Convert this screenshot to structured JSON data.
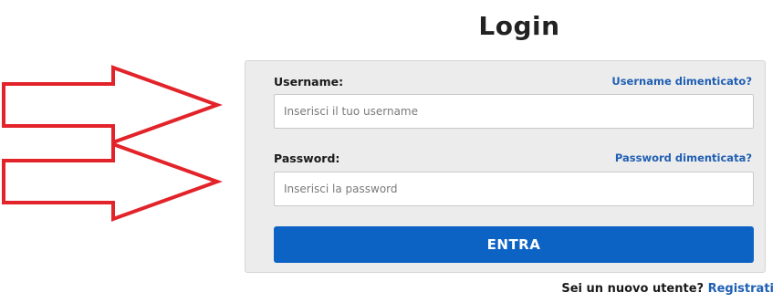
{
  "page": {
    "title": "Login"
  },
  "username": {
    "label": "Username:",
    "forgot_link": "Username dimenticato?",
    "placeholder": "Inserisci il tuo username",
    "value": ""
  },
  "password": {
    "label": "Password:",
    "forgot_link": "Password dimenticata?",
    "placeholder": "Inserisci la password",
    "value": ""
  },
  "submit": {
    "label": "ENTRA"
  },
  "register": {
    "prompt": "Sei un nuovo utente?",
    "link": "Registrati"
  },
  "colors": {
    "accent": "#0d63c4",
    "link": "#1f5fb3",
    "arrow": "#e2242a",
    "box_background": "#ececec"
  },
  "annotations": {
    "arrows": [
      "arrow-icon",
      "arrow-icon"
    ]
  }
}
